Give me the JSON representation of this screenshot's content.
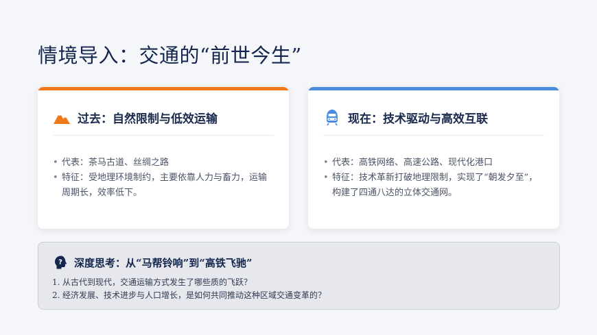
{
  "title": "情境导入：交通的“前世今生”",
  "colors": {
    "accent_orange": "#f07a1a",
    "accent_blue": "#4a8be0",
    "navy": "#14264d"
  },
  "cards": {
    "past": {
      "icon": "mountain-icon",
      "heading": "过去：自然限制与低效运输",
      "bullets": [
        "代表：茶马古道、丝绸之路",
        "特征：受地理环境制约，主要依靠人力与畜力，运输周期长，效率低下。"
      ]
    },
    "present": {
      "icon": "high-speed-train-icon",
      "heading": "现在：技术驱动与高效互联",
      "bullets": [
        "代表：高铁网络、高速公路、现代化港口",
        "特征：技术革新打破地理限制，实现了“朝发夕至”，构建了四通八达的立体交通网。"
      ]
    }
  },
  "thinking": {
    "icon": "head-question-icon",
    "heading": "深度思考：从“马帮铃响”到“高铁飞驰”",
    "questions": [
      {
        "num": "1.",
        "text": "从古代到现代，交通运输方式发生了哪些质的飞跃？"
      },
      {
        "num": "2.",
        "text": "经济发展、技术进步与人口增长，是如何共同推动这种区域交通变革的？"
      }
    ]
  }
}
